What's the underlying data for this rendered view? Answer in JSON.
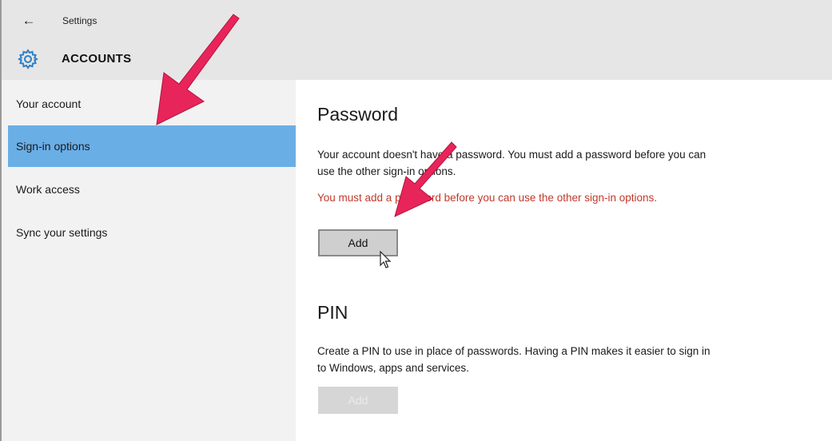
{
  "window": {
    "back_glyph": "←",
    "title": "Settings",
    "section_icon": "gear-icon",
    "section_title": "ACCOUNTS"
  },
  "sidebar": {
    "items": [
      {
        "label": "Your account",
        "selected": false
      },
      {
        "label": "Sign-in options",
        "selected": true
      },
      {
        "label": "Work access",
        "selected": false
      },
      {
        "label": "Sync your settings",
        "selected": false
      }
    ]
  },
  "password": {
    "heading": "Password",
    "description": "Your account doesn't have a password. You must add a password before you can use the other sign-in options.",
    "warning": "You must add a password before you can use the other sign-in options.",
    "add_label": "Add"
  },
  "pin": {
    "heading": "PIN",
    "description": "Create a PIN to use in place of passwords. Having a PIN makes it easier to sign in to Windows, apps and services.",
    "add_label": "Add",
    "add_enabled": false
  },
  "colors": {
    "accent_selected": "#6aaee6",
    "warning_text": "#c0392b",
    "annotation_arrow": "#e8255a",
    "gear": "#2e7fc8"
  }
}
